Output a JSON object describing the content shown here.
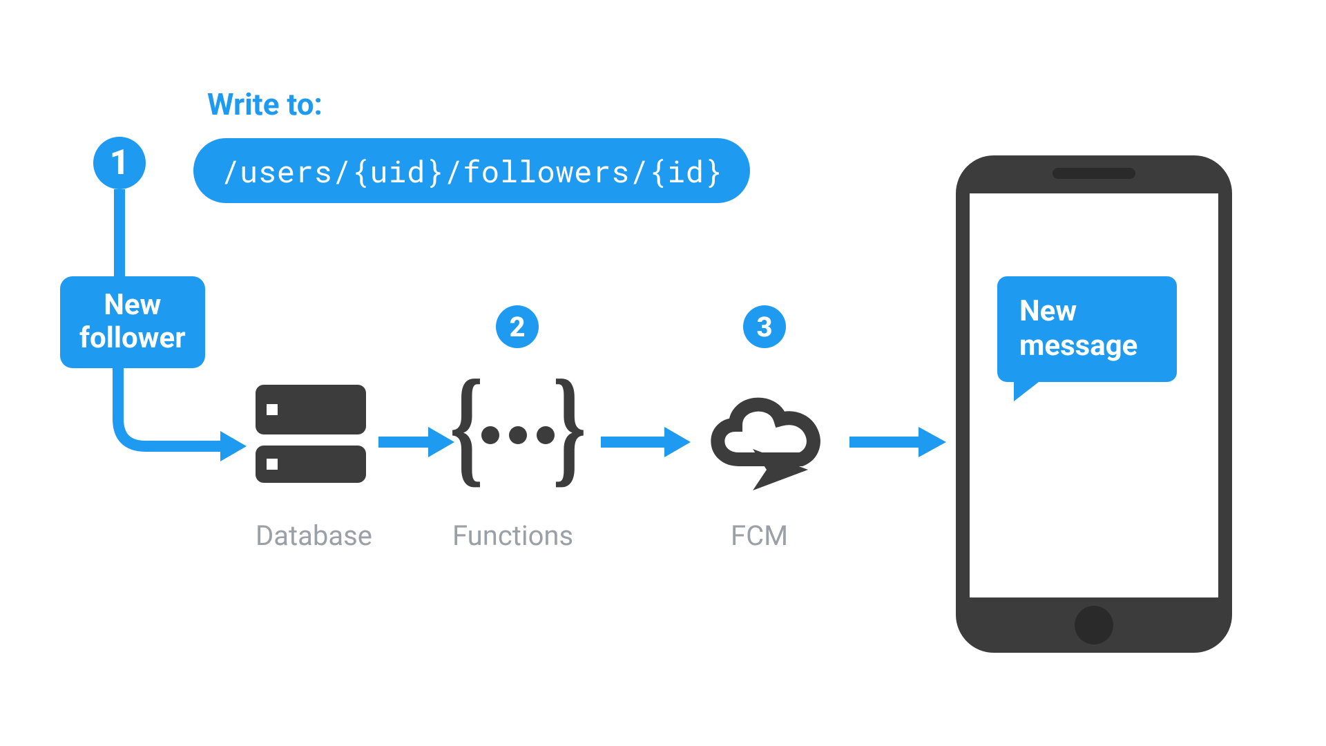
{
  "header": {
    "write_label": "Write to:",
    "path": "/users/{uid}/followers/{id}"
  },
  "steps": {
    "s1": "1",
    "s2": "2",
    "s3": "3"
  },
  "trigger": {
    "line1": "New",
    "line2": "follower"
  },
  "nodes": {
    "database": "Database",
    "functions": "Functions",
    "fcm": "FCM"
  },
  "phone": {
    "msg_line1": "New",
    "msg_line2": "message"
  }
}
